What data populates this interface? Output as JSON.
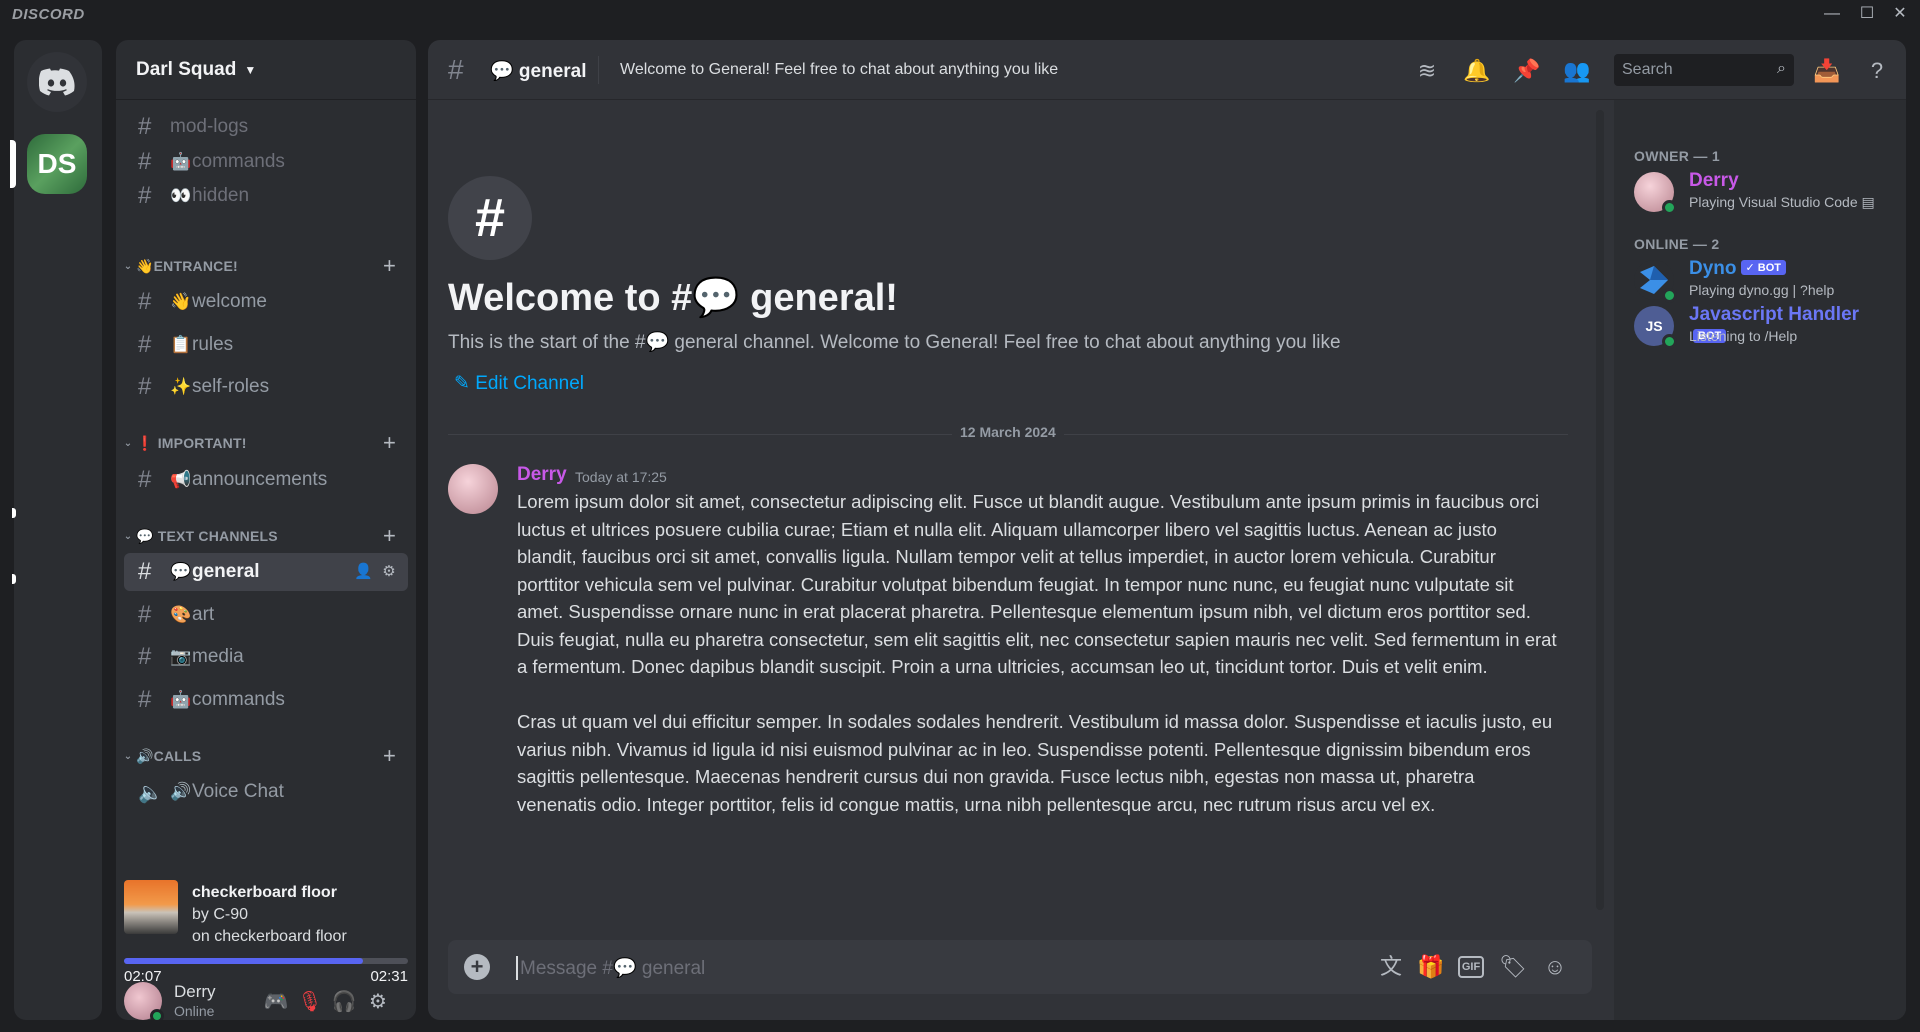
{
  "app": {
    "brand": "DISCORD"
  },
  "window": {
    "minimize": "—",
    "maximize": "☐",
    "close": "✕"
  },
  "server": {
    "name": "Darl Squad",
    "initials": "DS"
  },
  "channels_top": [
    {
      "emoji": "",
      "label": "mod-logs"
    },
    {
      "emoji": "🤖",
      "label": "commands"
    },
    {
      "emoji": "👀",
      "label": "hidden"
    }
  ],
  "categories": {
    "entrance": "👋ENTRANCE!",
    "important": "❗ IMPORTANT!",
    "text": "💬 TEXT CHANNELS",
    "calls": "🔊CALLS"
  },
  "channels_entrance": [
    {
      "emoji": "👋",
      "label": "welcome"
    },
    {
      "emoji": "📋",
      "label": "rules"
    },
    {
      "emoji": "✨",
      "label": "self-roles"
    }
  ],
  "channels_important": [
    {
      "emoji": "📢",
      "label": "announcements"
    }
  ],
  "channels_text": [
    {
      "emoji": "💬",
      "label": "general"
    },
    {
      "emoji": "🎨",
      "label": "art"
    },
    {
      "emoji": "📷",
      "label": "media"
    },
    {
      "emoji": "🤖",
      "label": "commands"
    }
  ],
  "channels_calls": [
    {
      "emoji": "🔊",
      "label": "Voice Chat"
    }
  ],
  "now_playing": {
    "title": "checkerboard floor",
    "by_prefix": "by ",
    "artist": "C-90",
    "on_prefix": "on ",
    "album": "checkerboard floor",
    "elapsed": "02:07",
    "total": "02:31",
    "progress": 0.84
  },
  "user": {
    "name": "Derry",
    "status": "Online"
  },
  "header": {
    "channel": "💬 general",
    "topic": "Welcome to General! Feel free to chat about anything you like",
    "search_placeholder": "Search"
  },
  "welcome": {
    "title": "Welcome to #💬 general!",
    "subtitle": "This is the start of the #💬 general channel. Welcome to General! Feel free to chat about anything you like",
    "edit": "Edit Channel"
  },
  "date_divider": "12 March 2024",
  "message": {
    "author": "Derry",
    "time": "Today at 17:25",
    "para1": "Lorem ipsum dolor sit amet, consectetur adipiscing elit. Fusce ut blandit augue. Vestibulum ante ipsum primis in faucibus orci luctus et ultrices posuere cubilia curae; Etiam et nulla elit. Aliquam ullamcorper libero vel sagittis luctus. Aenean ac justo blandit, faucibus orci sit amet, convallis ligula. Nullam tempor velit at tellus imperdiet, in auctor lorem vehicula. Curabitur porttitor vehicula sem vel pulvinar. Curabitur volutpat bibendum feugiat. In tempor nunc nunc, eu feugiat nunc vulputate sit amet. Suspendisse ornare nunc in erat placerat pharetra. Pellentesque elementum ipsum nibh, vel dictum eros porttitor sed. Duis feugiat, nulla eu pharetra consectetur, sem elit sagittis elit, nec consectetur sapien mauris nec velit. Sed fermentum in erat a fermentum. Donec dapibus blandit suscipit. Proin a urna ultricies, accumsan leo ut, tincidunt tortor. Duis et velit enim.",
    "para2": "Cras ut quam vel dui efficitur semper. In sodales sodales hendrerit. Vestibulum id massa dolor. Suspendisse et iaculis justo, eu varius nibh. Vivamus id ligula id nisi euismod pulvinar ac in leo. Suspendisse potenti. Pellentesque dignissim bibendum eros sagittis pellentesque. Maecenas hendrerit cursus dui non gravida. Fusce lectus nibh, egestas non massa ut, pharetra venenatis odio. Integer porttitor, felis id congue mattis, urna nibh pellentesque arcu, nec rutrum risus arcu vel ex."
  },
  "composer": {
    "placeholder": "Message #💬 general",
    "gif": "GIF"
  },
  "members": {
    "owner_heading": "OWNER — 1",
    "online_heading": "ONLINE — 2",
    "list": [
      {
        "name": "Derry",
        "activity": "Playing Visual Studio Code",
        "color": "#c859e8",
        "bot": ""
      },
      {
        "name": "Dyno",
        "activity": "Playing dyno.gg | ?help",
        "color": "#3b8fe6",
        "bot": "✓ BOT"
      },
      {
        "name": "Javascript Handler",
        "activity": "Listening to /Help",
        "color": "#6b77f5",
        "bot": "BOT"
      }
    ]
  },
  "colors": {
    "accent": "#5865f2",
    "online": "#23a55a",
    "link": "#00a8fc"
  }
}
